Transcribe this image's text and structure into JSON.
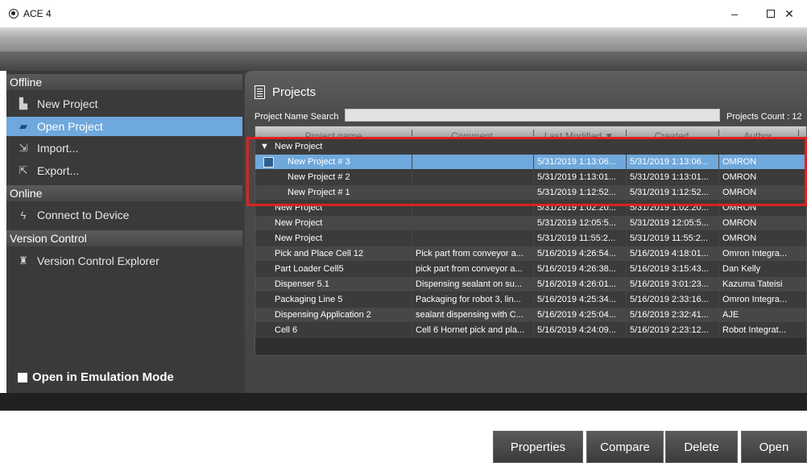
{
  "window": {
    "title": "ACE 4",
    "minimize": "–",
    "close": "✕"
  },
  "sidebar": {
    "sections": [
      {
        "title": "Offline",
        "items": [
          {
            "label": "New Project",
            "icon": "new-project-icon",
            "selected": false
          },
          {
            "label": "Open Project",
            "icon": "folder-open-icon",
            "selected": true
          },
          {
            "label": "Import...",
            "icon": "import-icon",
            "selected": false
          },
          {
            "label": "Export...",
            "icon": "export-icon",
            "selected": false
          }
        ]
      },
      {
        "title": "Online",
        "items": [
          {
            "label": "Connect to Device",
            "icon": "lightning-icon",
            "selected": false
          }
        ]
      },
      {
        "title": "Version Control",
        "items": [
          {
            "label": "Version Control Explorer",
            "icon": "version-control-icon",
            "selected": false
          }
        ]
      }
    ],
    "emulation_label": "Open in Emulation Mode"
  },
  "projects": {
    "title": "Projects",
    "search_label": "Project Name Search",
    "search_value": "",
    "count_label": "Projects Count : 12",
    "columns": [
      "Project name",
      "Comment",
      "Last Modified ▼",
      "Created",
      "Author"
    ],
    "group": {
      "expander": "▼",
      "label": "New Project"
    },
    "rows": [
      {
        "name": "New Project # 3",
        "comment": "",
        "modified": "5/31/2019 1:13:06...",
        "created": "5/31/2019 1:13:06...",
        "author": "OMRON",
        "selected": true,
        "in_group": true
      },
      {
        "name": "New Project # 2",
        "comment": "",
        "modified": "5/31/2019 1:13:01...",
        "created": "5/31/2019 1:13:01...",
        "author": "OMRON",
        "selected": false,
        "in_group": true
      },
      {
        "name": "New Project # 1",
        "comment": "",
        "modified": "5/31/2019 1:12:52...",
        "created": "5/31/2019 1:12:52...",
        "author": "OMRON",
        "selected": false,
        "in_group": true
      },
      {
        "name": "New Project",
        "comment": "",
        "modified": "5/31/2019 1:02:20...",
        "created": "5/31/2019 1:02:20...",
        "author": "OMRON",
        "selected": false,
        "in_group": false
      },
      {
        "name": "New Project",
        "comment": "",
        "modified": "5/31/2019 12:05:5...",
        "created": "5/31/2019 12:05:5...",
        "author": "OMRON",
        "selected": false,
        "in_group": false
      },
      {
        "name": "New Project",
        "comment": "",
        "modified": "5/31/2019 11:55:2...",
        "created": "5/31/2019 11:55:2...",
        "author": "OMRON",
        "selected": false,
        "in_group": false
      },
      {
        "name": "Pick and Place Cell 12",
        "comment": "Pick part from conveyor a...",
        "modified": "5/16/2019 4:26:54...",
        "created": "5/16/2019 4:18:01...",
        "author": "Omron Integra...",
        "selected": false,
        "in_group": false
      },
      {
        "name": "Part Loader Cell5",
        "comment": "pick part from conveyor a...",
        "modified": "5/16/2019 4:26:38...",
        "created": "5/16/2019 3:15:43...",
        "author": "Dan Kelly",
        "selected": false,
        "in_group": false
      },
      {
        "name": "Dispenser 5.1",
        "comment": "Dispensing sealant on su...",
        "modified": "5/16/2019 4:26:01...",
        "created": "5/16/2019 3:01:23...",
        "author": "Kazuma Tateisi",
        "selected": false,
        "in_group": false
      },
      {
        "name": "Packaging Line 5",
        "comment": "Packaging for robot 3, lin...",
        "modified": "5/16/2019 4:25:34...",
        "created": "5/16/2019 2:33:16...",
        "author": "Omron Integra...",
        "selected": false,
        "in_group": false
      },
      {
        "name": "Dispensing Application 2",
        "comment": "sealant dispensing with C...",
        "modified": "5/16/2019 4:25:04...",
        "created": "5/16/2019 2:32:41...",
        "author": "AJE",
        "selected": false,
        "in_group": false
      },
      {
        "name": "Cell 6",
        "comment": "Cell 6 Hornet pick and pla...",
        "modified": "5/16/2019 4:24:09...",
        "created": "5/16/2019 2:23:12...",
        "author": "Robot Integrat...",
        "selected": false,
        "in_group": false
      }
    ]
  },
  "actions": [
    "Properties",
    "Compare",
    "Delete",
    "Open"
  ],
  "colors": {
    "selection": "#6fa8dc",
    "highlight": "#e02020"
  }
}
